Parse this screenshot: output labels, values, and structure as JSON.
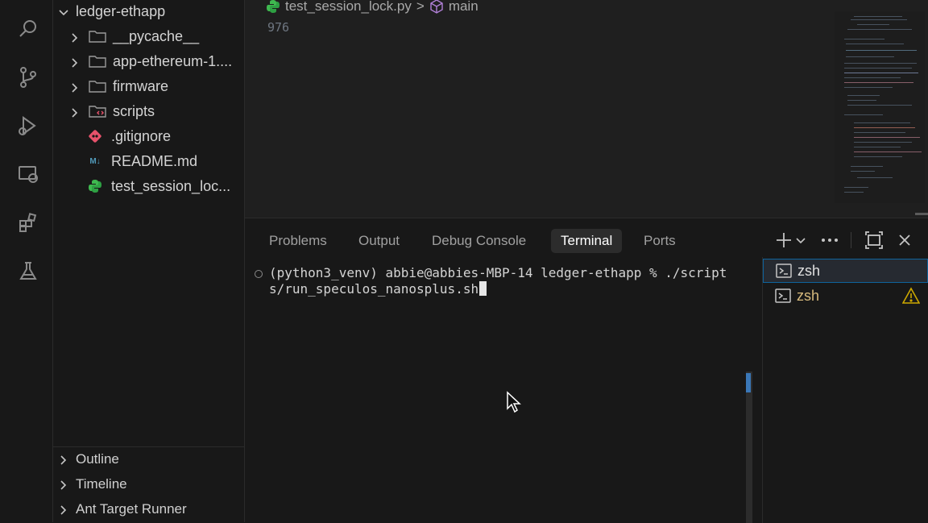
{
  "explorer": {
    "root": "ledger-ethapp",
    "items": [
      {
        "label": "__pycache__",
        "kind": "folder"
      },
      {
        "label": "app-ethereum-1....",
        "kind": "folder"
      },
      {
        "label": "firmware",
        "kind": "folder"
      },
      {
        "label": "scripts",
        "kind": "folder"
      },
      {
        "label": ".gitignore",
        "kind": "git"
      },
      {
        "label": "README.md",
        "kind": "markdown",
        "icon_text": "M↓"
      },
      {
        "label": "test_session_loc...",
        "kind": "python"
      }
    ],
    "sections": [
      {
        "label": "Outline"
      },
      {
        "label": "Timeline"
      },
      {
        "label": "Ant Target Runner"
      }
    ]
  },
  "editor": {
    "breadcrumb_file": "test_session_lock.py",
    "breadcrumb_separator": ">",
    "breadcrumb_symbol": "main",
    "line_number": "976"
  },
  "panel": {
    "tabs": [
      {
        "label": "Problems"
      },
      {
        "label": "Output"
      },
      {
        "label": "Debug Console"
      },
      {
        "label": "Terminal",
        "active": true
      },
      {
        "label": "Ports"
      }
    ],
    "terminal": {
      "line1": "(python3_venv) abbie@abbies-MBP-14 ledger-ethapp % ./script",
      "line2": "s/run_speculos_nanosplus.sh"
    },
    "terminals": [
      {
        "label": "zsh",
        "selected": true,
        "warning": false
      },
      {
        "label": "zsh",
        "selected": false,
        "warning": true
      }
    ]
  },
  "colors": {
    "accent": "#0e639c",
    "warning": "#cca700",
    "zsh_warning_text": "#d7ba7d",
    "python_icon": "#3fb950",
    "git_icon": "#e8526b",
    "markdown_icon": "#519aba"
  }
}
